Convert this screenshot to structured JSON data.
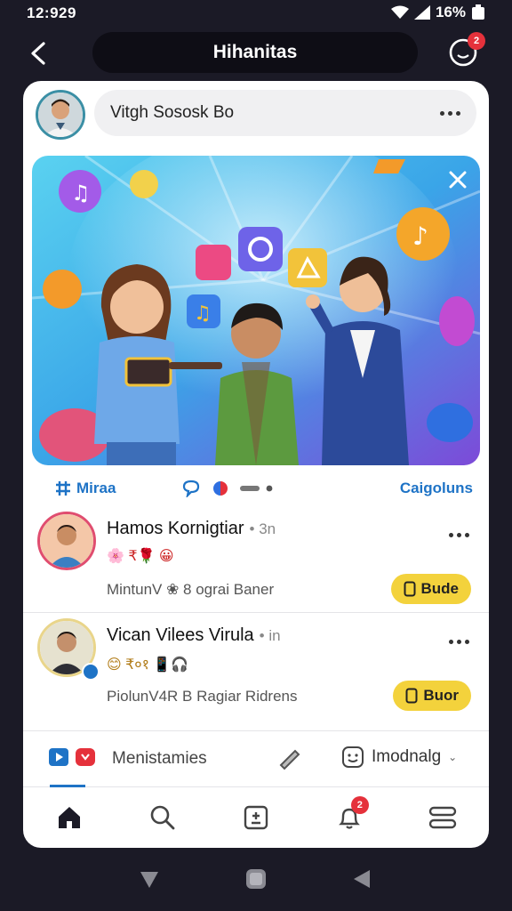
{
  "status_bar": {
    "time": "12:929",
    "battery": "16%"
  },
  "header": {
    "title": "Hihanitas",
    "notification_count": "2"
  },
  "composer": {
    "placeholder_text": "Vitgh Sososk Bo"
  },
  "action_row": {
    "media_label": "Miraa",
    "categories_label": "Caigoluns"
  },
  "posts": [
    {
      "name": "Hamos Kornigtiar",
      "time": "• 3n",
      "emojis": "🌸 ₹🌹 😀",
      "sub": "MintunV ❀ 8 ograi  Baner",
      "button": "Bude",
      "accent": "#e04d6f"
    },
    {
      "name": "Vican Vilees Virula",
      "time": "• in",
      "emojis": "😊 ₹०१ 📱🎧",
      "sub": "PiolunV4R  B  Ragiar Ridrens",
      "button": "Buor",
      "accent": "#3b8fa5"
    }
  ],
  "tab_strip": {
    "label": "Menistamies",
    "mood_label": "Imodnalg"
  },
  "bottom_nav": {
    "notification_count": "2"
  },
  "colors": {
    "accent_blue": "#1e73c6",
    "badge_red": "#e5313b",
    "button_yellow": "#f3d23c",
    "background": "#1b1a26"
  }
}
